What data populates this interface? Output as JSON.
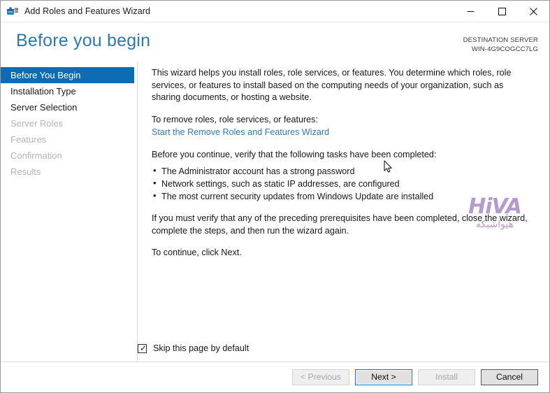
{
  "window": {
    "title": "Add Roles and Features Wizard",
    "icon": "server-toolbox-icon",
    "controls": {
      "minimize": "–",
      "maximize": "☐",
      "close": "✕"
    }
  },
  "header": {
    "page_title": "Before you begin",
    "destination_label": "DESTINATION SERVER",
    "destination_name": "WIN-4G9COGCC7LG"
  },
  "sidebar": {
    "items": [
      {
        "label": "Before You Begin",
        "state": "selected"
      },
      {
        "label": "Installation Type",
        "state": "enabled"
      },
      {
        "label": "Server Selection",
        "state": "enabled"
      },
      {
        "label": "Server Roles",
        "state": "disabled"
      },
      {
        "label": "Features",
        "state": "disabled"
      },
      {
        "label": "Confirmation",
        "state": "disabled"
      },
      {
        "label": "Results",
        "state": "disabled"
      }
    ]
  },
  "content": {
    "intro": "This wizard helps you install roles, role services, or features. You determine which roles, role services, or features to install based on the computing needs of your organization, such as sharing documents, or hosting a website.",
    "remove_prompt": "To remove roles, role services, or features:",
    "remove_link": "Start the Remove Roles and Features Wizard",
    "verify_prompt": "Before you continue, verify that the following tasks have been completed:",
    "tasks": [
      "The Administrator account has a strong password",
      "Network settings, such as static IP addresses, are configured",
      "The most current security updates from Windows Update are installed"
    ],
    "recheck": "If you must verify that any of the preceding prerequisites have been completed, close the wizard, complete the steps, and then run the wizard again.",
    "continue": "To continue, click Next."
  },
  "watermark": {
    "mark": "HiVA",
    "subtitle": "هیواشبکه",
    "color": "#b49bcd",
    "accent": "#f2c53d"
  },
  "options": {
    "skip_page_label": "Skip this page by default",
    "skip_page_checked": true,
    "check_glyph": "✓"
  },
  "footer": {
    "buttons": [
      {
        "label": "< Previous",
        "state": "disabled"
      },
      {
        "label": "Next >",
        "state": "default"
      },
      {
        "label": "Install",
        "state": "disabled"
      },
      {
        "label": "Cancel",
        "state": "enabled"
      }
    ]
  },
  "colors": {
    "accent_blue": "#0d6cb3",
    "title_blue": "#2c7aad",
    "link_blue": "#2f7bb5",
    "focus_blue": "#0078d7"
  }
}
